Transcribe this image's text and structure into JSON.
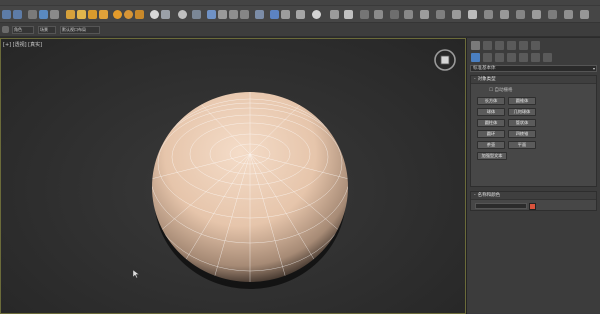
{
  "toolbar": {
    "command_set": [
      "角色",
      "场景",
      "默认视口布局"
    ]
  },
  "viewport": {
    "label": "[+] [透视] [真实]"
  },
  "command_panel": {
    "dropdown_value": "标准基本体",
    "object_type": {
      "title": "对象类型",
      "autogrid_label": "自动栅格",
      "buttons": [
        "长方体",
        "圆锥体",
        "球体",
        "几何球体",
        "圆柱体",
        "管状体",
        "圆环",
        "四棱锥",
        "茶壶",
        "平面",
        "加强型文本"
      ]
    },
    "name_color": {
      "title": "名称和颜色",
      "object_color": "#d9533c"
    }
  },
  "colors": {
    "sphere": "#e9c9b0",
    "viewport_border": "#6b6b3a"
  }
}
